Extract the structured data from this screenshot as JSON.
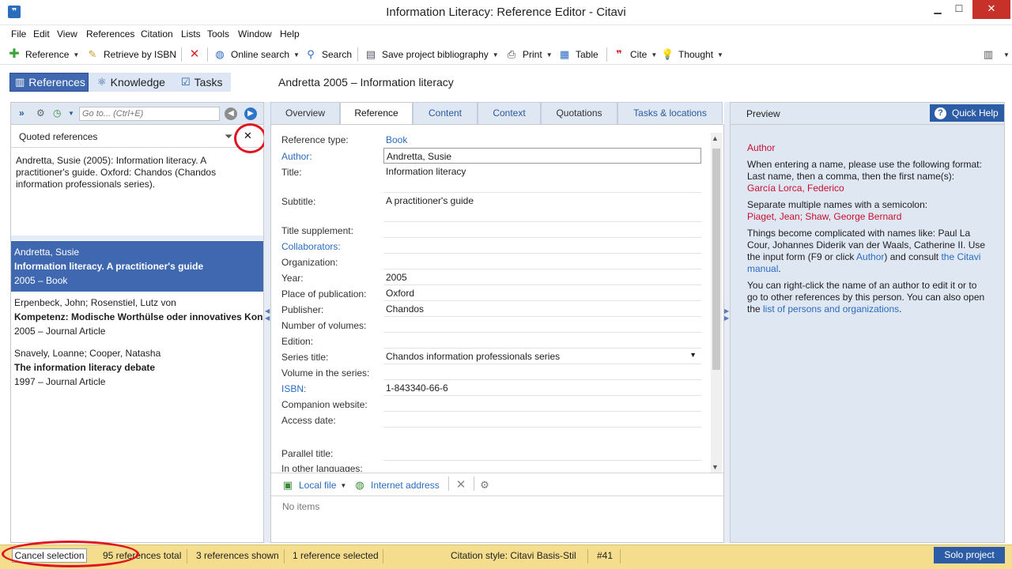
{
  "window": {
    "title": "Information Literacy: Reference Editor - Citavi",
    "app_icon": "❞",
    "minimize": "▁",
    "maximize": "☐",
    "close": "✕"
  },
  "menu": [
    "File",
    "Edit",
    "View",
    "References",
    "Citation",
    "Lists",
    "Tools",
    "Window",
    "Help"
  ],
  "toolbar": {
    "reference": "Reference",
    "retrieve_isbn": "Retrieve by ISBN",
    "online_search": "Online search",
    "search": "Search",
    "save_bibliography": "Save project bibliography",
    "print": "Print",
    "table": "Table",
    "cite": "Cite",
    "thought": "Thought"
  },
  "nav": {
    "references": "References",
    "knowledge": "Knowledge",
    "tasks": "Tasks",
    "current_title": "Andretta 2005 – Information literacy"
  },
  "left": {
    "goto_placeholder": "Go to... (Ctrl+E)",
    "filter_label": "Quoted references",
    "citation_preview": "Andretta, Susie (2005): Information literacy. A practitioner's guide. Oxford: Chandos (Chandos information professionals series).",
    "references": [
      {
        "authors": "Andretta, Susie",
        "title": "Information literacy. A practitioner's guide",
        "meta": "2005 – Book",
        "selected": true
      },
      {
        "authors": "Erpenbeck, John; Rosenstiel, Lutz von",
        "title": "Kompetenz: Modische Worthülse oder innovatives Konz",
        "meta": "2005 – Journal Article",
        "selected": false
      },
      {
        "authors": "Snavely, Loanne; Cooper, Natasha",
        "title": "The information literacy debate",
        "meta": "1997 – Journal Article",
        "selected": false
      }
    ]
  },
  "tabs": [
    "Overview",
    "Reference",
    "Content",
    "Context",
    "Quotations",
    "Tasks & locations"
  ],
  "fields": [
    {
      "label": "Reference type:",
      "value": "Book"
    },
    {
      "label": "Author:",
      "value": "Andretta, Susie"
    },
    {
      "label": "Title:",
      "value": "Information literacy"
    },
    {
      "label": "Subtitle:",
      "value": "A practitioner's guide"
    },
    {
      "label": "Title supplement:",
      "value": ""
    },
    {
      "label": "Collaborators:",
      "value": ""
    },
    {
      "label": "Organization:",
      "value": ""
    },
    {
      "label": "Year:",
      "value": "2005"
    },
    {
      "label": "Place of publication:",
      "value": "Oxford"
    },
    {
      "label": "Publisher:",
      "value": "Chandos"
    },
    {
      "label": "Number of volumes:",
      "value": ""
    },
    {
      "label": "Edition:",
      "value": ""
    },
    {
      "label": "Series title:",
      "value": "Chandos information professionals series"
    },
    {
      "label": "Volume in the series:",
      "value": ""
    },
    {
      "label": "ISBN:",
      "value": "1-843340-66-6"
    },
    {
      "label": "Companion website:",
      "value": ""
    },
    {
      "label": "Access date:",
      "value": ""
    },
    {
      "label": "Parallel title:",
      "value": ""
    },
    {
      "label": "In other languages:",
      "value": ""
    }
  ],
  "attachments": {
    "local_file": "Local file",
    "internet_address": "Internet address",
    "no_items": "No items"
  },
  "preview": {
    "label": "Preview",
    "quick_help": "Quick Help",
    "heading": "Author",
    "p1": "When entering a name, please use the following format: Last name, then a comma, then the first name(s):",
    "ex1": "García Lorca, Federico",
    "p2": "Separate multiple names with a semicolon:",
    "ex2": "Piaget, Jean; Shaw, George Bernard",
    "p3a": "Things become complicated with names like: Paul La Cour, Johannes Diderik van der Waals, Catherine II. Use the input form (F9 or click ",
    "p3link1": "Author",
    "p3b": ") and consult ",
    "p3link2": "the Citavi manual",
    "p3c": ".",
    "p4a": "You can right-click the name of an author to edit it or to go to other references by this person. You can also open the ",
    "p4link": "list of persons and organizations",
    "p4b": "."
  },
  "status": {
    "cancel": "Cancel selection",
    "total": "95 references total",
    "shown": "3 references shown",
    "selected": "1 reference selected",
    "style": "Citation style: Citavi Basis-Stil",
    "number": "#41",
    "solo": "Solo project"
  },
  "colors": {
    "accent": "#3f68b0",
    "link": "#2a6bbf",
    "highlight_circle": "#e0141e",
    "status_bar": "#f5dd8e"
  }
}
